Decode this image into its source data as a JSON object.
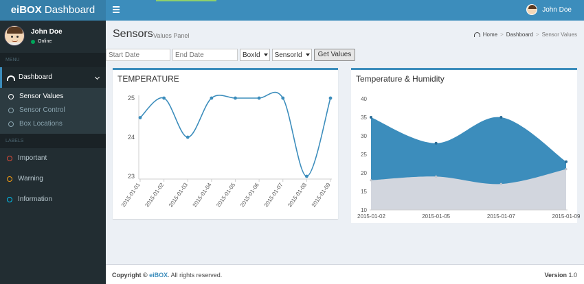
{
  "app": {
    "logo_prefix": "eiBOX",
    "logo_suffix": "Dashboard"
  },
  "header": {
    "user_name": "John Doe"
  },
  "sidebar": {
    "user_name": "John Doe",
    "status": "Online",
    "menu_header": "MENU",
    "dashboard_label": "Dashboard",
    "submenu": [
      {
        "label": "Sensor Values"
      },
      {
        "label": "Sensor Control"
      },
      {
        "label": "Box Locations"
      }
    ],
    "labels_header": "LABELS",
    "labels": [
      {
        "label": "Important",
        "color": "#dd4b39"
      },
      {
        "label": "Warning",
        "color": "#f39c12"
      },
      {
        "label": "Information",
        "color": "#00c0ef"
      }
    ]
  },
  "page": {
    "title": "Sensors",
    "subtitle": "Values Panel"
  },
  "breadcrumb": {
    "home": "Home",
    "dashboard": "Dashboard",
    "current": "Sensor Values"
  },
  "filters": {
    "start_placeholder": "Start Date",
    "end_placeholder": "End Date",
    "box_select": "BoxId",
    "sensor_select": "SensorId",
    "button": "Get Values"
  },
  "chart_data": [
    {
      "type": "line",
      "title": "TEMPERATURE",
      "categories": [
        "2015-01-01",
        "2015-01-02",
        "2015-01-03",
        "2015-01-04",
        "2015-01-05",
        "2015-01-06",
        "2015-01-07",
        "2015-01-08",
        "2015-01-09"
      ],
      "values": [
        24.5,
        25,
        24,
        25,
        25,
        25,
        25,
        23,
        25
      ],
      "ylim": [
        23,
        25
      ],
      "yticks": [
        "25",
        "24",
        "23"
      ],
      "color": "#3c8dbc"
    },
    {
      "type": "area",
      "title": "Temperature & Humidity",
      "categories": [
        "2015-01-02",
        "2015-01-05",
        "2015-01-07",
        "2015-01-09"
      ],
      "series": [
        {
          "values": [
            35,
            28,
            35,
            23
          ],
          "color": "#3c8dbc"
        },
        {
          "values": [
            18,
            19,
            17,
            21
          ],
          "color": "#d2d6de"
        }
      ],
      "ylim": [
        10,
        40
      ],
      "yticks": [
        "40",
        "35",
        "30",
        "25",
        "20",
        "15",
        "10"
      ]
    }
  ],
  "footer": {
    "copyright_prefix": "Copyright ©",
    "brand": "eiBOX",
    "rights": ". All rights reserved.",
    "version_label": "Version",
    "version": "1.0"
  }
}
